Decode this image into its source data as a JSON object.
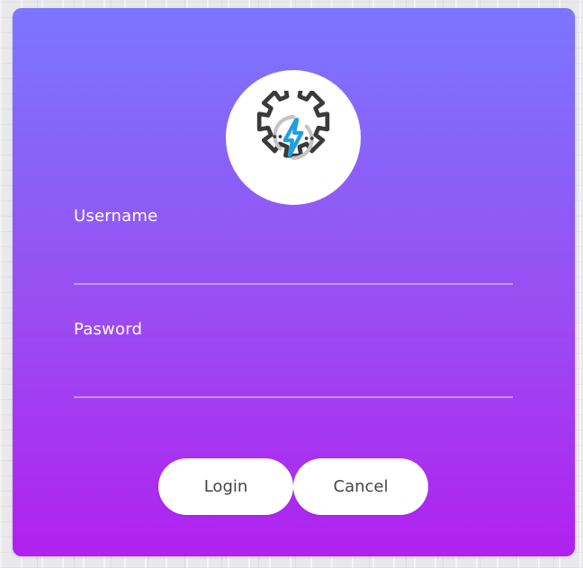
{
  "form": {
    "logo_icon": "gear-lightning-icon",
    "username_label": "Username",
    "username_value": "",
    "password_label": "Pasword",
    "password_value": "",
    "login_label": "Login",
    "cancel_label": "Cancel"
  },
  "colors": {
    "gradient_top": "#7a76ff",
    "gradient_bottom": "#b021ef",
    "gear_stroke": "#3a3a3a",
    "bolt": "#1f9fe0",
    "arc": "#c4c4c4",
    "button_text": "#444444"
  }
}
